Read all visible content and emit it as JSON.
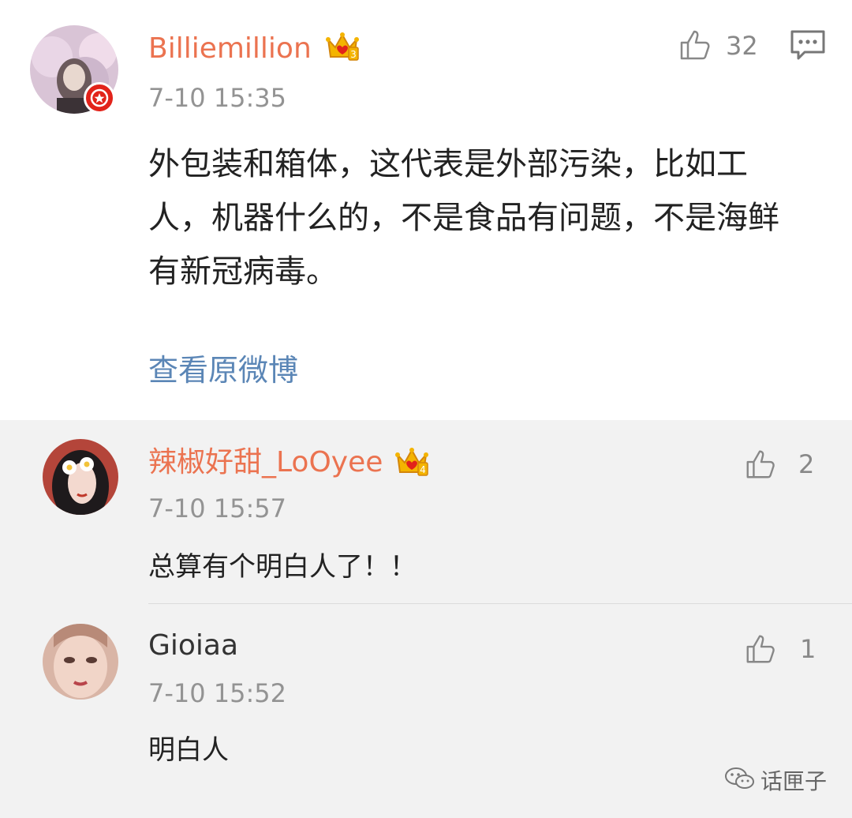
{
  "post": {
    "author": "Billiemillion",
    "time": "7-10 15:35",
    "text": "外包装和箱体，这代表是外部污染，比如工人，机器什么的，不是食品有问题，不是海鲜有新冠病毒。",
    "likes": "32",
    "view_original": "查看原微博",
    "crown_level": "3",
    "icons": {
      "like": "thumbs-up-icon",
      "comment": "comment-icon",
      "verified": "verified-badge-icon",
      "crown": "crown-icon"
    },
    "colors": {
      "name": "#eb7350",
      "link": "#5b86b6",
      "badge": "#e2231a",
      "crown": "#f4b400"
    }
  },
  "replies": [
    {
      "author": "辣椒好甜_LoOyee",
      "time": "7-10 15:57",
      "text": "总算有个明白人了！！",
      "likes": "2",
      "crown_level": "4"
    },
    {
      "author": "Gioiaa",
      "time": "7-10 15:52",
      "text": "明白人",
      "likes": "1"
    }
  ],
  "watermark": {
    "text": "话匣子",
    "icon": "wechat-icon"
  }
}
